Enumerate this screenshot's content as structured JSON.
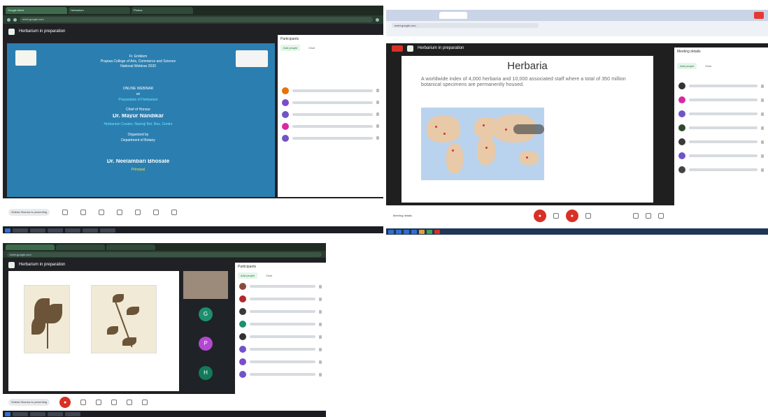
{
  "shot1": {
    "meet_title": "Herbarium in preparation",
    "panel_title": "Participants",
    "add_people": "Add people",
    "chat_btn": "Chat",
    "slide_lines": [
      "Fr. Emblem",
      "Prajnaa College of Arts, Commerce and Science",
      "National Webinar 2020",
      "ONLINE WEBINAR",
      "on",
      "Preparation of Herbarium",
      "Chief of Honour",
      "Dr. Mayur Nandikar",
      "Herbarium Curator, Naoroji Bot. Res. Centre",
      "Organized by",
      "Department of Botany",
      "Dr. Neelambari Bhosale",
      "Principal"
    ],
    "presenting": "Shikha Sharma is presenting",
    "tabs": [
      "Google Meet",
      "Herbarium",
      "Photos"
    ],
    "url": "meet.google.com"
  },
  "shot2": {
    "meet_title": "Herbarium in preparation",
    "slide_title": "Herbaria",
    "slide_text": "A worldwide index of 4,000 herbaria and 10,000 associated staff where a total of 350 million botanical specimens are permanently housed.",
    "presenting": "Meeting details",
    "panel_title": "Meeting details",
    "add_people": "Add people",
    "chat_btn": "Chat",
    "url": "meet.google.com"
  },
  "shot3": {
    "meet_title": "Herbarium in preparation",
    "panel_title": "Participants",
    "add_people": "Add people",
    "chat_btn": "Chat",
    "bubbles": [
      "G",
      "P",
      "H"
    ],
    "presenting": "Shikha Sharma is presenting",
    "url": "meet.google.com"
  },
  "colors": {
    "meet_red": "#d93025",
    "meet_green": "#188038",
    "avatar_orange": "#e8710a",
    "avatar_purple": "#7a4cc9",
    "avatar_pink": "#d92aa2",
    "avatar_violet": "#6f55c8",
    "tile_green": "#1e8e6e",
    "tile_magenta": "#b348d1",
    "tile_teal": "#117a5a"
  }
}
